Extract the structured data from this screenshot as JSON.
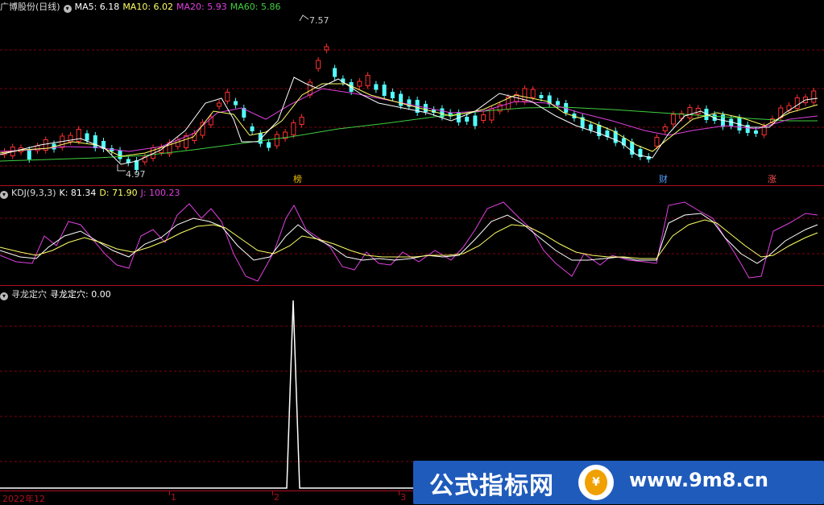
{
  "main": {
    "title": "广博股份(日线)",
    "ma": [
      {
        "label": "MA5: 6.18",
        "color": "#ffffff"
      },
      {
        "label": "MA10: 6.02",
        "color": "#ffff66"
      },
      {
        "label": "MA20: 5.93",
        "color": "#e040e0"
      },
      {
        "label": "MA60: 5.86",
        "color": "#40d040"
      }
    ],
    "high_label": "7.57",
    "low_label": "4.97",
    "markers": [
      "榜",
      "财",
      "涨"
    ]
  },
  "kdj": {
    "title": "KDJ(9,3,3)",
    "k": "K: 81.34",
    "d": "D: 71.90",
    "j": "J: 100.23"
  },
  "indicator": {
    "title": "寻龙定穴",
    "value": "寻龙定穴: 0.00"
  },
  "x_axis": {
    "labels": [
      "2022年12",
      "1",
      "2",
      "3"
    ]
  },
  "watermark": {
    "text": "公式指标网",
    "url": "www.9m8.cn"
  },
  "colors": {
    "up": "#ff3030",
    "down": "#54ffff",
    "grid": "#800010",
    "separator": "#b01020"
  }
}
